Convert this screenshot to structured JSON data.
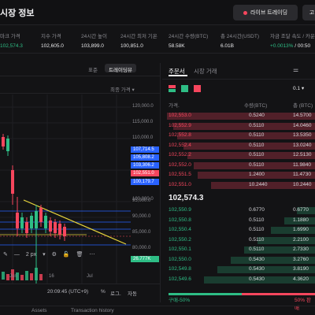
{
  "header": {
    "title": "시장 정보",
    "live_button": "라이브 트레이딩",
    "cut_button": "고"
  },
  "stats": [
    {
      "label": "마크 가격",
      "value": "102,574.3",
      "color": "green"
    },
    {
      "label": "지수 가격",
      "value": "102,605.0",
      "color": "default"
    },
    {
      "label": "24시간 높이",
      "value": "103,899.0",
      "color": "default"
    },
    {
      "label": "24시간 최저 기온",
      "value": "100,851.0",
      "color": "default"
    },
    {
      "label": "24시간 수량(BTC)",
      "value": "58.58K",
      "color": "default"
    },
    {
      "label": "총 24시간(USDT)",
      "value": "6.01B",
      "color": "default"
    },
    {
      "label": "자금 조달 속도 / 카운트다운",
      "value": "+0.0013%",
      "value2": "/ 00:50",
      "color": "green"
    }
  ],
  "chart": {
    "tab_standard": "표준",
    "tab_tradingview": "트레이딩뷰",
    "price_type": "최종 가격",
    "price_axis": [
      "120,000.0",
      "115,000.0",
      "110,000.0",
      "100,000.0",
      "95,000.0",
      "90,000.0",
      "85,000.0",
      "80,000.0"
    ],
    "price_tags": [
      {
        "label": "107,714.5",
        "color": "#2962ff"
      },
      {
        "label": "105,808.2",
        "color": "#2962ff"
      },
      {
        "label": "103,306.2",
        "color": "#2962ff"
      },
      {
        "label": "102,551.0",
        "color": "#f6465d"
      },
      {
        "label": "100,179.7",
        "color": "#2962ff"
      }
    ],
    "volume_tag": "26.777K",
    "x_axis": [
      "Jun",
      "16",
      "Jul"
    ],
    "toolbar_width": "2 px",
    "time": "20:09:45 (UTC+9)",
    "percent": "%",
    "log": "로그.",
    "auto": "자동",
    "annotation": "90,000"
  },
  "orderbook": {
    "tab_orderbook": "주문서",
    "tab_trades": "시장 거래",
    "precision": "0.1",
    "col_price": "가격.",
    "col_qty": "수량(BTC)",
    "col_total": "총 (BTC)",
    "asks": [
      {
        "price": "102,553.0",
        "qty": "0.5240",
        "total": "14.5700",
        "fill": 1.0
      },
      {
        "price": "102,552.9",
        "qty": "0.5110",
        "total": "14.0460",
        "fill": 0.96
      },
      {
        "price": "102,552.8",
        "qty": "0.5110",
        "total": "13.5350",
        "fill": 0.93
      },
      {
        "price": "102,552.4",
        "qty": "0.5110",
        "total": "13.0240",
        "fill": 0.89
      },
      {
        "price": "102,552.2",
        "qty": "0.5110",
        "total": "12.5130",
        "fill": 0.86
      },
      {
        "price": "102,552.0",
        "qty": "0.5110",
        "total": "11.9840",
        "fill": 0.82
      },
      {
        "price": "102,551.5",
        "qty": "1.2400",
        "total": "11.4730",
        "fill": 0.79
      },
      {
        "price": "102,551.0",
        "qty": "10.2440",
        "total": "10.2440",
        "fill": 0.7
      }
    ],
    "last_price": "102,574.3",
    "bids": [
      {
        "price": "102,550.9",
        "qty": "0.6770",
        "total": "0.6770",
        "fill": 0.12
      },
      {
        "price": "102,550.8",
        "qty": "0.5110",
        "total": "1.1880",
        "fill": 0.21
      },
      {
        "price": "102,550.4",
        "qty": "0.5110",
        "total": "1.6990",
        "fill": 0.3
      },
      {
        "price": "102,550.2",
        "qty": "0.5110",
        "total": "2.2100",
        "fill": 0.39
      },
      {
        "price": "102,550.1",
        "qty": "0.5110",
        "total": "2.7330",
        "fill": 0.48
      },
      {
        "price": "102,550.0",
        "qty": "0.5430",
        "total": "3.2760",
        "fill": 0.57
      },
      {
        "price": "102,549.8",
        "qty": "0.5430",
        "total": "3.8190",
        "fill": 0.66
      },
      {
        "price": "102,549.6",
        "qty": "0.5430",
        "total": "4.3620",
        "fill": 0.75
      }
    ],
    "buy_ratio": "구매-50%",
    "sell_ratio": "50% 판매",
    "buy_fraction": 0.5
  },
  "bottom": {
    "tab1": "",
    "tab2": "Assets",
    "tab3": "Transaction history"
  }
}
